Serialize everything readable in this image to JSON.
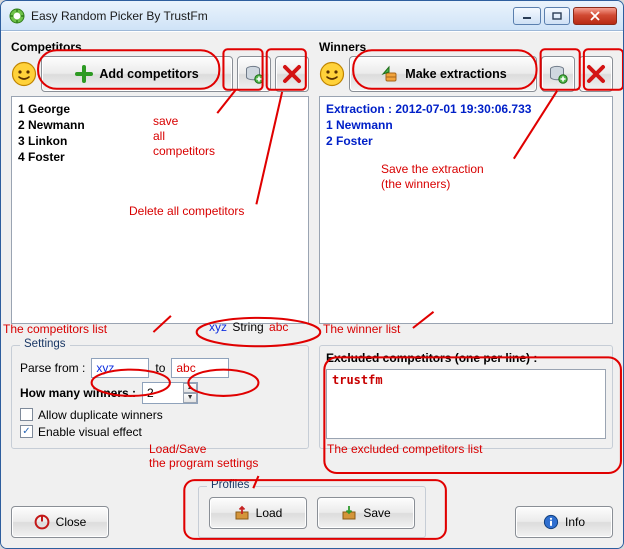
{
  "window": {
    "title": "Easy Random Picker By TrustFm"
  },
  "competitors": {
    "title": "Competitors",
    "add_label": "Add competitors",
    "list": [
      "1 George",
      "2 Newmann",
      "3 Linkon",
      "4 Foster"
    ],
    "example_string": "String"
  },
  "winners": {
    "title": "Winners",
    "make_label": "Make extractions",
    "extraction_line": "Extraction : 2012-07-01 19:30:06.733",
    "list": [
      "1 Newmann",
      "2 Foster"
    ]
  },
  "settings": {
    "legend": "Settings",
    "parse_from_label": "Parse from :",
    "parse_from_value": "xyz",
    "parse_to_label": "to",
    "parse_to_value": "abc",
    "how_many_label": "How many winners :",
    "how_many_value": "2",
    "allow_duplicate_label": "Allow duplicate winners",
    "allow_duplicate_checked": false,
    "enable_visual_label": "Enable visual effect",
    "enable_visual_checked": true
  },
  "excluded": {
    "title": "Excluded competitors (one per line) :",
    "value": "trustfm"
  },
  "profiles": {
    "legend": "Profiles",
    "load_label": "Load",
    "save_label": "Save"
  },
  "buttons": {
    "close": "Close",
    "info": "Info"
  },
  "annotations": {
    "save_all_competitors": "save\nall\ncompetitors",
    "delete_all_competitors": "Delete all competitors",
    "competitors_list": "The competitors list",
    "save_extraction": "Save the extraction\n(the winners)",
    "winner_list": "The winner list",
    "excluded_list": "The excluded competitors list",
    "load_save_settings": "Load/Save\nthe program settings",
    "xyz": "xyz",
    "abc": "abc"
  }
}
